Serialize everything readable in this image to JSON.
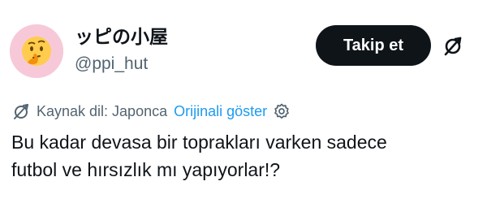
{
  "user": {
    "display_name": "ッピの小屋",
    "handle": "@ppi_hut",
    "avatar": "thinking-face-emoji"
  },
  "follow_button": {
    "label": "Takip et"
  },
  "more_icon": "translate-slash-icon",
  "translation": {
    "source_label": "Kaynak dil: Japonca",
    "show_original": "Orijinali göster",
    "icon": "translate-icon",
    "settings_icon": "gear-icon"
  },
  "tweet": {
    "lines": [
      "Bu kadar devasa bir toprakları varken sadece",
      "futbol ve hırsızlık mı yapıyorlar!?"
    ]
  },
  "colors": {
    "text": "#0f1419",
    "secondary": "#536471",
    "link": "#1d9bf0",
    "button_bg": "#0f1419",
    "button_text": "#ffffff",
    "avatar_bg": "#f7c9d8"
  }
}
